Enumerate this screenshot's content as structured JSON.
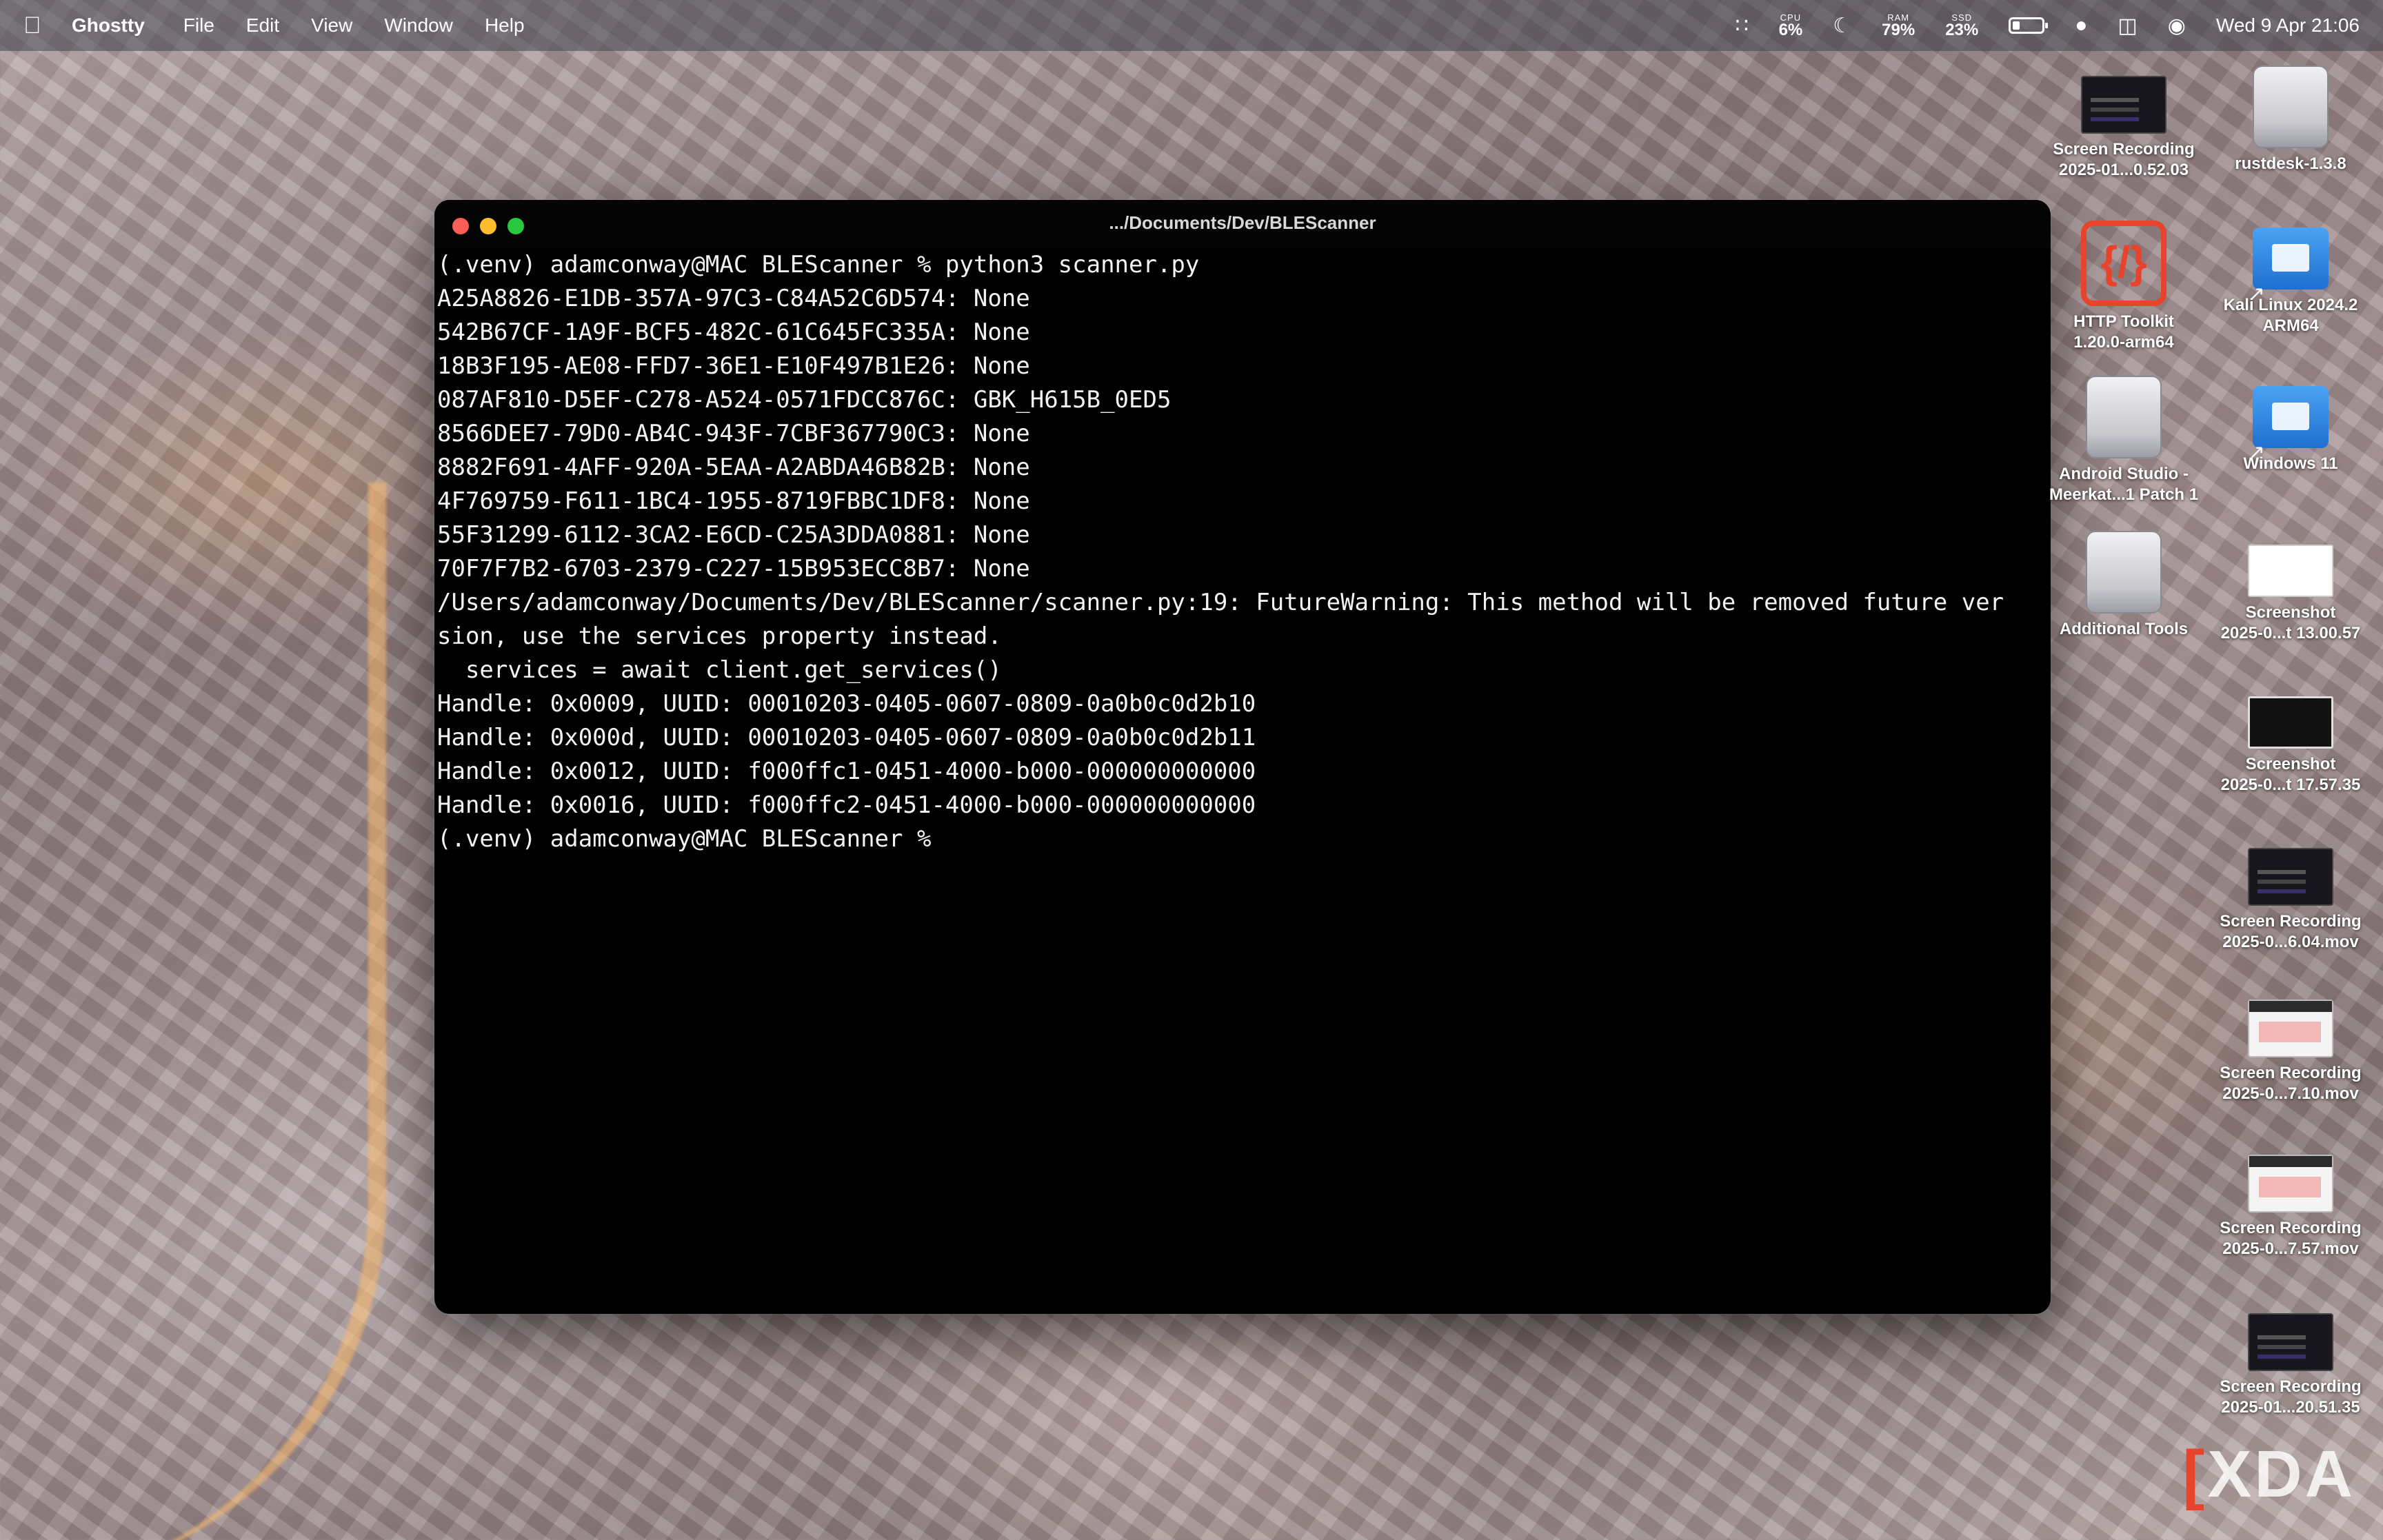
{
  "menubar": {
    "app_name": "Ghostty",
    "menus": [
      "File",
      "Edit",
      "View",
      "Window",
      "Help"
    ],
    "cpu_label": "CPU",
    "cpu_value": "6%",
    "ram_label": "RAM",
    "ram_value": "79%",
    "ssd_label": "SSD",
    "ssd_value": "23%",
    "battery_level": 0.25,
    "datetime": "Wed 9 Apr  21:06"
  },
  "terminal": {
    "title": ".../Documents/Dev/BLEScanner",
    "lines": [
      "(.venv) adamconway@MAC BLEScanner % python3 scanner.py",
      "A25A8826-E1DB-357A-97C3-C84A52C6D574: None",
      "542B67CF-1A9F-BCF5-482C-61C645FC335A: None",
      "18B3F195-AE08-FFD7-36E1-E10F497B1E26: None",
      "087AF810-D5EF-C278-A524-0571FDCC876C: GBK_H615B_0ED5",
      "8566DEE7-79D0-AB4C-943F-7CBF367790C3: None",
      "8882F691-4AFF-920A-5EAA-A2ABDA46B82B: None",
      "4F769759-F611-1BC4-1955-8719FBBC1DF8: None",
      "55F31299-6112-3CA2-E6CD-C25A3DDA0881: None",
      "70F7F7B2-6703-2379-C227-15B953ECC8B7: None",
      "/Users/adamconway/Documents/Dev/BLEScanner/scanner.py:19: FutureWarning: This method will be removed future ver",
      "sion, use the services property instead.",
      "  services = await client.get_services()",
      "Handle: 0x0009, UUID: 00010203-0405-0607-0809-0a0b0c0d2b10",
      "Handle: 0x000d, UUID: 00010203-0405-0607-0809-0a0b0c0d2b11",
      "Handle: 0x0012, UUID: f000ffc1-0451-4000-b000-000000000000",
      "Handle: 0x0016, UUID: f000ffc2-0451-4000-b000-000000000000",
      "(.venv) adamconway@MAC BLEScanner %"
    ]
  },
  "desktop_icons": [
    {
      "label1": "Screen Recording",
      "label2": "2025-01...0.52.03",
      "kind": "video-thumbnail"
    },
    {
      "label1": "rustdesk-1.3.8",
      "label2": "",
      "kind": "disk-image"
    },
    {
      "label1": "HTTP Toolkit",
      "label2": "1.20.0-arm64",
      "kind": "http-toolkit-icon"
    },
    {
      "label1": "Kali Linux 2024.2",
      "label2": "ARM64",
      "kind": "vm-alias"
    },
    {
      "label1": "Android Studio -",
      "label2": "Meerkat...1 Patch 1",
      "kind": "disk-image"
    },
    {
      "label1": "Windows 11",
      "label2": "",
      "kind": "vm-alias"
    },
    {
      "label1": "Additional Tools",
      "label2": "",
      "kind": "disk-image"
    },
    {
      "label1": "Screenshot",
      "label2": "2025-0...t 13.00.57",
      "kind": "screenshot-thumbnail"
    },
    {
      "label1": "Screenshot",
      "label2": "2025-0...t 17.57.35",
      "kind": "terminal-screenshot-thumbnail"
    },
    {
      "label1": "Screen Recording",
      "label2": "2025-0...6.04.mov",
      "kind": "video-thumbnail"
    },
    {
      "label1": "Screen Recording",
      "label2": "2025-0...7.10.mov",
      "kind": "light-video-thumbnail"
    },
    {
      "label1": "Screen Recording",
      "label2": "2025-0...7.57.mov",
      "kind": "light-video-thumbnail"
    },
    {
      "label1": "Screen Recording",
      "label2": "2025-01...20.51.35",
      "kind": "video-thumbnail"
    }
  ],
  "watermark": "XDA"
}
